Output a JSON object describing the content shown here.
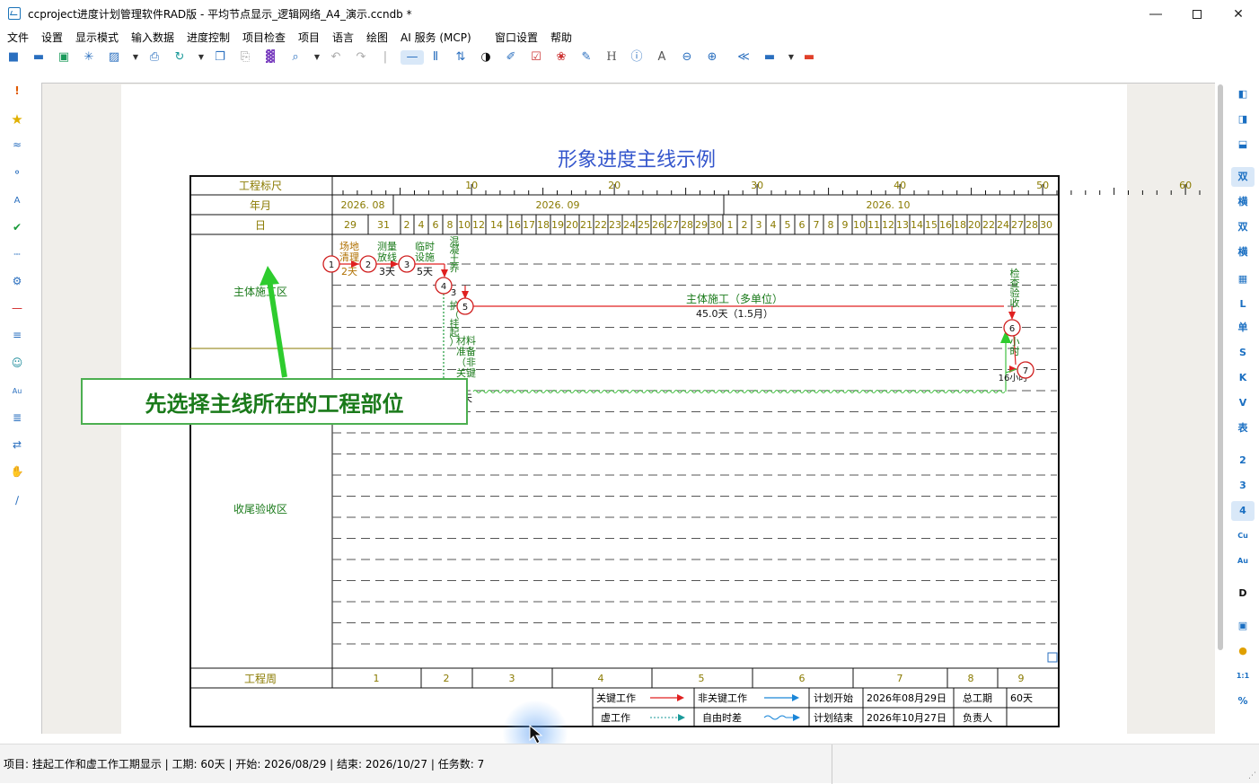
{
  "window": {
    "title": "ccproject进度计划管理软件RAD版 - 平均节点显示_逻辑网络_A4_演示.ccndb *",
    "minimize_icon": "minimize-icon",
    "maximize_icon": "maximize-icon",
    "close_icon": "close-icon"
  },
  "menu": [
    "文件",
    "设置",
    "显示模式",
    "输入数据",
    "进度控制",
    "项目检查",
    "项目",
    "语言",
    "绘图",
    "AI 服务 (MCP)",
    "窗口设置",
    "帮助"
  ],
  "right_panel": {
    "buttons": [
      "双",
      "横",
      "双",
      "横",
      "L",
      "单",
      "S",
      "K",
      "V",
      "表",
      "2",
      "3",
      "4",
      "Cu",
      "Au",
      "D",
      "1:1",
      "%"
    ],
    "selected": [
      "双",
      "4"
    ]
  },
  "chart": {
    "title": "形象进度主线示例",
    "row_labels": {
      "scale": "工程标尺",
      "month": "年月",
      "day": "日",
      "week": "工程周"
    },
    "scale_ticks": [
      "10",
      "20",
      "30",
      "40",
      "50",
      "60"
    ],
    "months": [
      "2026. 08",
      "2026. 09",
      "2026. 10"
    ],
    "days": [
      "29",
      "31",
      "2",
      "4",
      "6",
      "8",
      "10",
      "12",
      "14",
      "16",
      "17",
      "18",
      "19",
      "20",
      "21",
      "22",
      "23",
      "24",
      "25",
      "26",
      "27",
      "28",
      "29",
      "30",
      "1",
      "2",
      "3",
      "4",
      "5",
      "6",
      "7",
      "8",
      "9",
      "10",
      "11",
      "12",
      "13",
      "14",
      "15",
      "16",
      "18",
      "20",
      "22",
      "24",
      "27",
      "28",
      "30"
    ],
    "weeks": [
      "1",
      "2",
      "3",
      "4",
      "5",
      "6",
      "7",
      "8",
      "9"
    ],
    "zones": [
      "主体施工区",
      "收尾验收区"
    ],
    "nodes": [
      "1",
      "2",
      "3",
      "4",
      "5",
      "6",
      "7"
    ],
    "tasks": [
      {
        "name": "场地清理",
        "duration": "2天"
      },
      {
        "name": "测量放线",
        "duration": "3天"
      },
      {
        "name": "临时设施",
        "duration": "5天"
      },
      {
        "name": "混凝土养护（挂起）",
        "duration": "3"
      },
      {
        "name": "主体施工（多单位）",
        "duration": "45.0天（1.5月）"
      },
      {
        "name": "材料准备（非关键",
        "duration": "5天"
      },
      {
        "name": "检查验收",
        "duration": ""
      },
      {
        "name": "小时",
        "duration": "16小时"
      }
    ],
    "legend": {
      "critical": "关键工作",
      "noncritical": "非关键工作",
      "virtual": "虚工作",
      "free_float": "自由时差",
      "plan_start_label": "计划开始",
      "plan_start": "2026年08月29日",
      "plan_end_label": "计划结束",
      "plan_end": "2026年10月27日",
      "total_label": "总工期",
      "total": "60天",
      "owner_label": "负责人",
      "owner": ""
    }
  },
  "callout": "先选择主线所在的工程部位",
  "status": "项目: 挂起工作和虚工作工期显示 | 工期: 60天 | 开始: 2026/08/29 | 结束: 2026/10/27 | 任务数: 7",
  "colors": {
    "critical": "#e02020",
    "noncritical": "#1a86d8",
    "virtual": "#1a9a9a",
    "float": "#3fbf3f",
    "title": "#3355cc",
    "label": "#8a7a00"
  }
}
